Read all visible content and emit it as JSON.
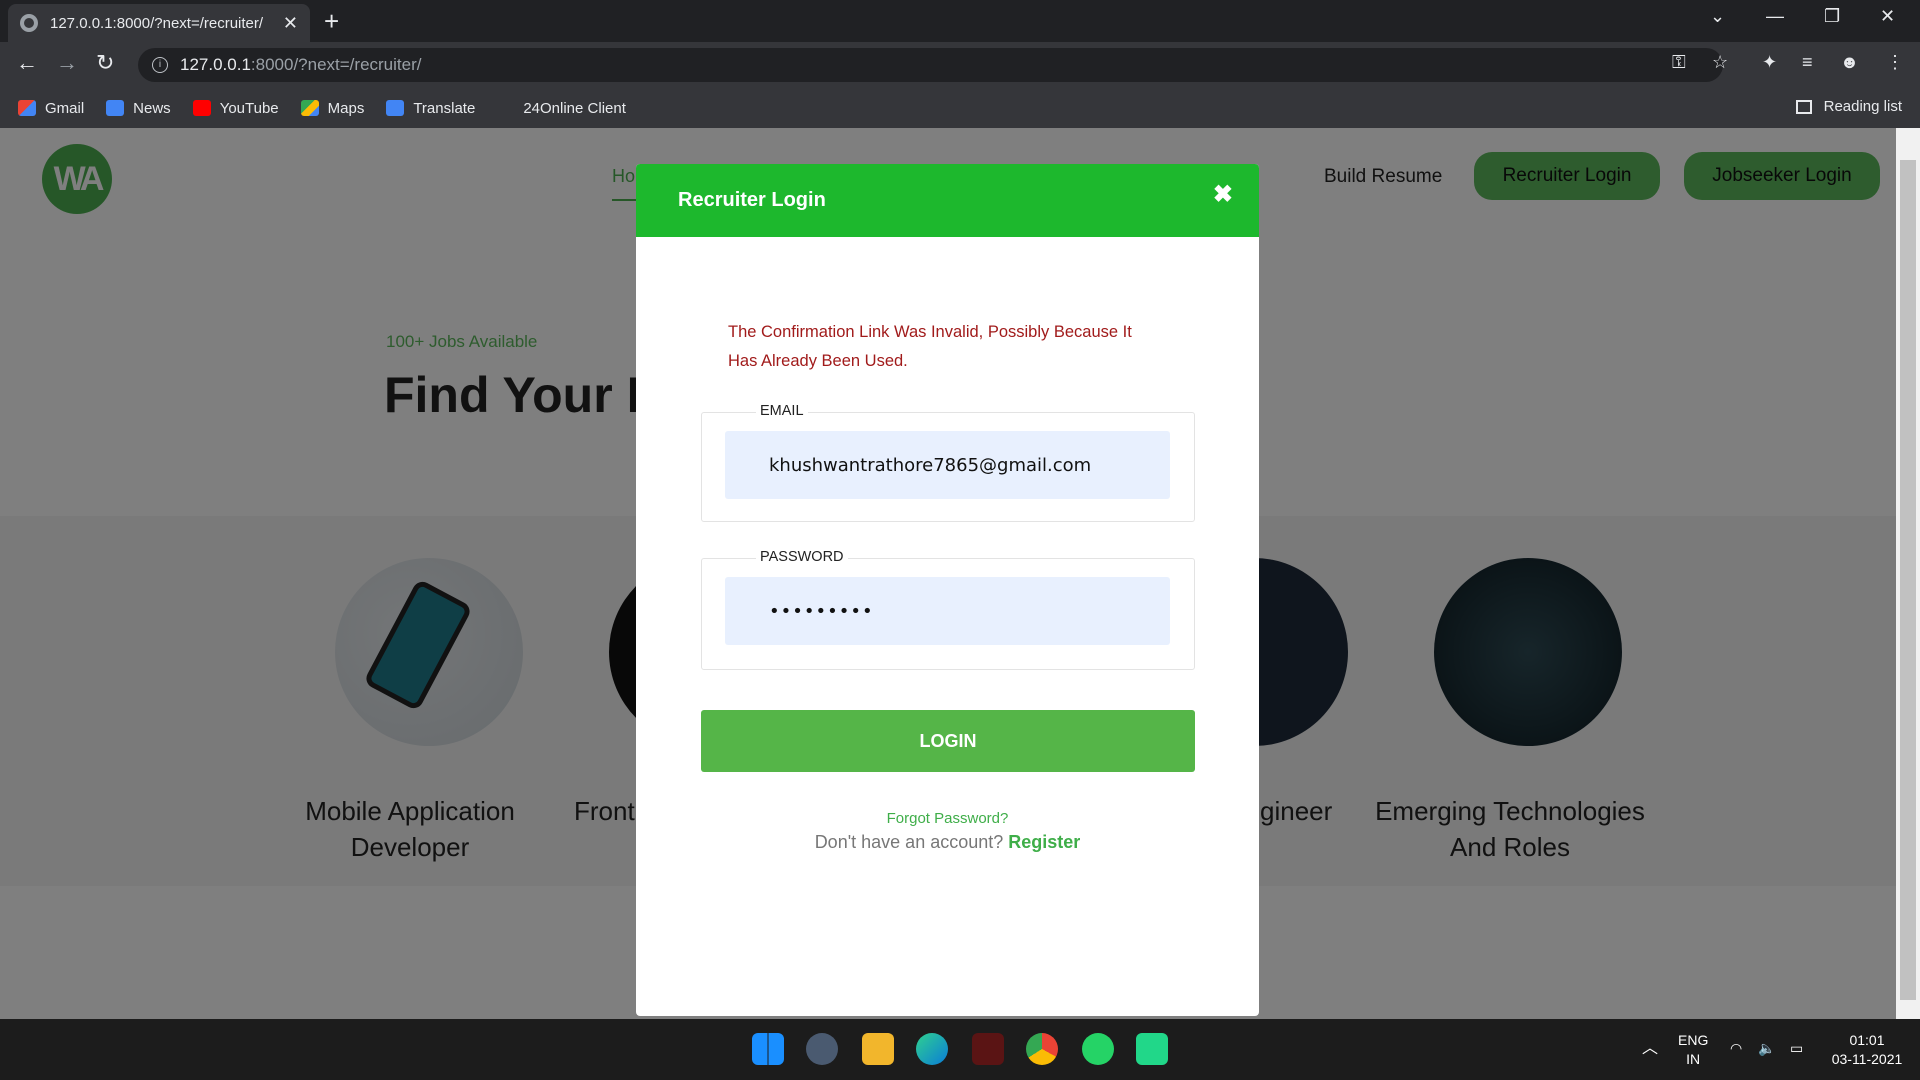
{
  "browser": {
    "tab_title": "127.0.0.1:8000/?next=/recruiter/",
    "url_host": "127.0.0.1",
    "url_rest": ":8000/?next=/recruiter/",
    "bookmarks": [
      "Gmail",
      "News",
      "YouTube",
      "Maps",
      "Translate",
      "24Online Client"
    ],
    "reading_list": "Reading list"
  },
  "site": {
    "logo_text": "WA",
    "nav_home": "Ho",
    "nav_build_resume": "Build Resume",
    "nav_recruiter_login": "Recruiter Login",
    "nav_jobseeker_login": "Jobseeker Login",
    "hero_subtitle": "100+ Jobs Available",
    "hero_title": "Find Your N",
    "categories": [
      {
        "label_line1": "Mobile Application",
        "label_line2": "Developer"
      },
      {
        "label_line1": "Front",
        "label_line2": ""
      },
      {
        "label_line1": "gineer",
        "label_line2": ""
      },
      {
        "label_line1": "Emerging Technologies",
        "label_line2": "And Roles"
      }
    ],
    "accent_color": "#5cb85c"
  },
  "modal": {
    "title": "Recruiter Login",
    "close_glyph": "✖",
    "error_line1": "The Confirmation Link Was Invalid, Possibly Because It",
    "error_line2": "Has Already Been Used.",
    "email_legend": "EMAIL",
    "email_value": "khushwantrathore7865@gmail.com",
    "password_legend": "PASSWORD",
    "password_value": "password1",
    "login_label": "LOGIN",
    "forgot_label": "Forgot Password?",
    "no_account_label": "Don't have an account?",
    "register_label": "Register",
    "header_color": "#1db82d",
    "button_color": "#55b548"
  },
  "taskbar": {
    "lang_line1": "ENG",
    "lang_line2": "IN",
    "time": "01:01",
    "date": "03-11-2021"
  }
}
